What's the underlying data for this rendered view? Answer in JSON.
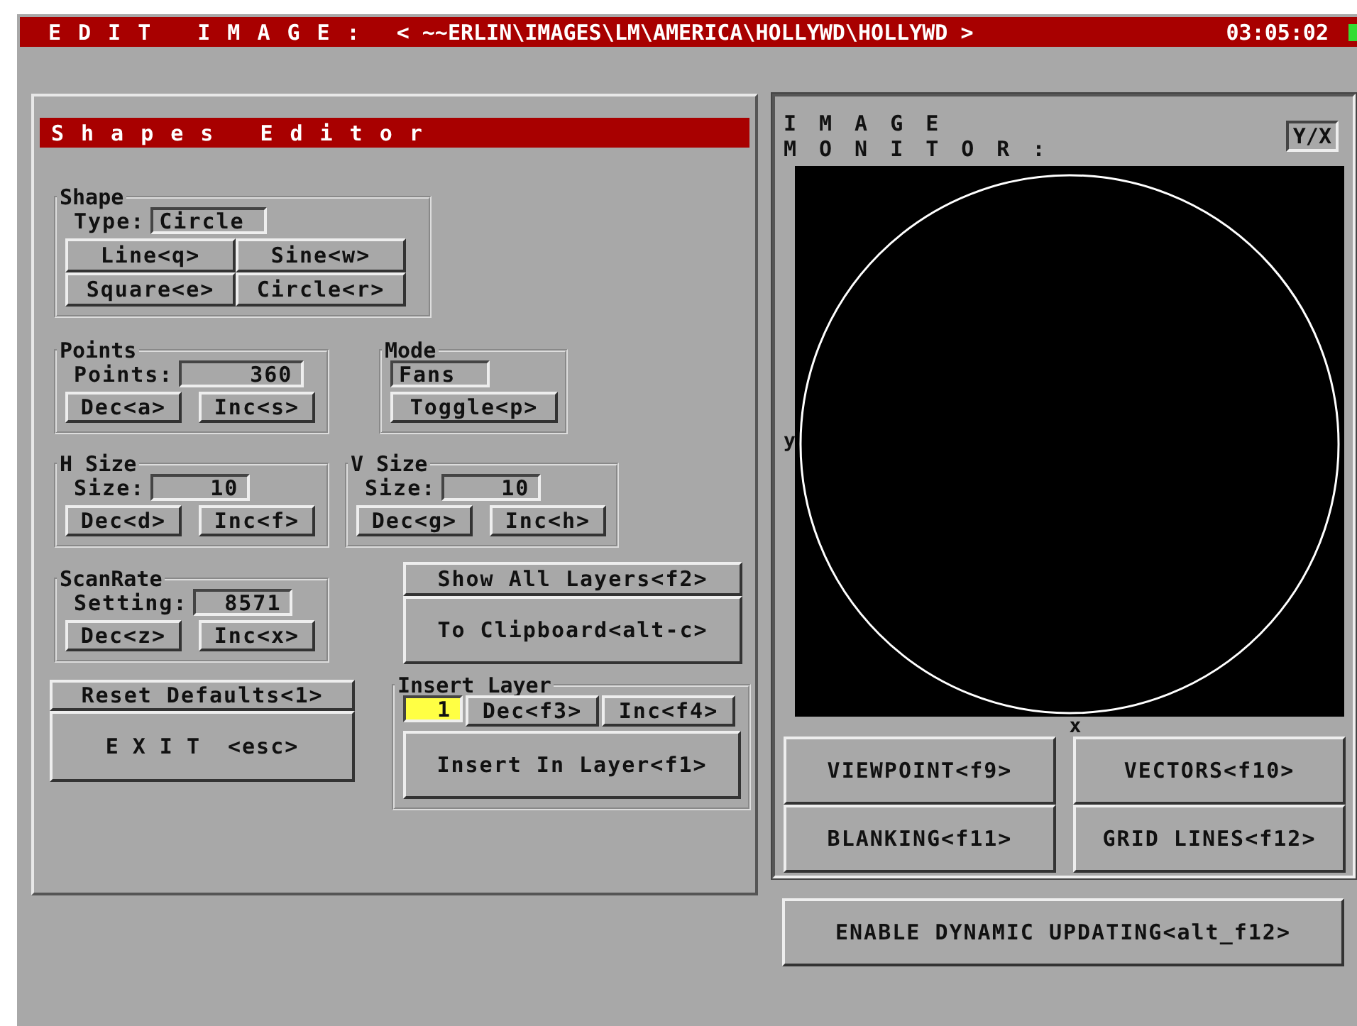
{
  "title_bar": {
    "title": "EDIT IMAGE:",
    "path": "< ~~ERLIN\\IMAGES\\LM\\AMERICA\\HOLLYWD\\HOLLYWD >",
    "time": "03:05:02"
  },
  "shapes_editor": {
    "title": "Shapes Editor",
    "shape": {
      "legend": "Shape",
      "type_label": "Type:",
      "type_value": "Circle",
      "buttons": [
        "Line<q>",
        "Sine<w>",
        "Square<e>",
        "Circle<r>"
      ]
    },
    "points": {
      "legend": "Points",
      "label": "Points:",
      "value": "360",
      "buttons": [
        "Dec<a>",
        "Inc<s>"
      ]
    },
    "mode": {
      "legend": "Mode",
      "value": "Fans",
      "button": "Toggle<p>"
    },
    "h_size": {
      "legend": "H Size",
      "label": "Size:",
      "value": "10",
      "buttons": [
        "Dec<d>",
        "Inc<f>"
      ]
    },
    "v_size": {
      "legend": "V Size",
      "label": "Size:",
      "value": "10",
      "buttons": [
        "Dec<g>",
        "Inc<h>"
      ]
    },
    "scan_rate": {
      "legend": "ScanRate",
      "label": "Setting:",
      "value": "8571",
      "buttons": [
        "Dec<z>",
        "Inc<x>"
      ]
    },
    "reset_button": "Reset Defaults<1>",
    "exit_button": {
      "label": "EXIT",
      "key": "<esc>"
    },
    "show_all_button": "Show All Layers<f2>",
    "clipboard_button": "To Clipboard<alt-c>",
    "insert_layer": {
      "legend": "Insert Layer",
      "value": "1",
      "selected": true,
      "buttons": [
        "Dec<f3>",
        "Inc<f4>"
      ],
      "insert_button": "Insert In Layer<f1>"
    }
  },
  "image_monitor": {
    "title": "IMAGE MONITOR:",
    "axes_mode": "Y/X",
    "y_label": "y",
    "x_label": "x",
    "buttons": [
      "VIEWPOINT<f9>",
      "VECTORS<f10>",
      "BLANKING<f11>",
      "GRID LINES<f12>"
    ]
  },
  "dynamic_button": "ENABLE DYNAMIC UPDATING<alt_f12>"
}
